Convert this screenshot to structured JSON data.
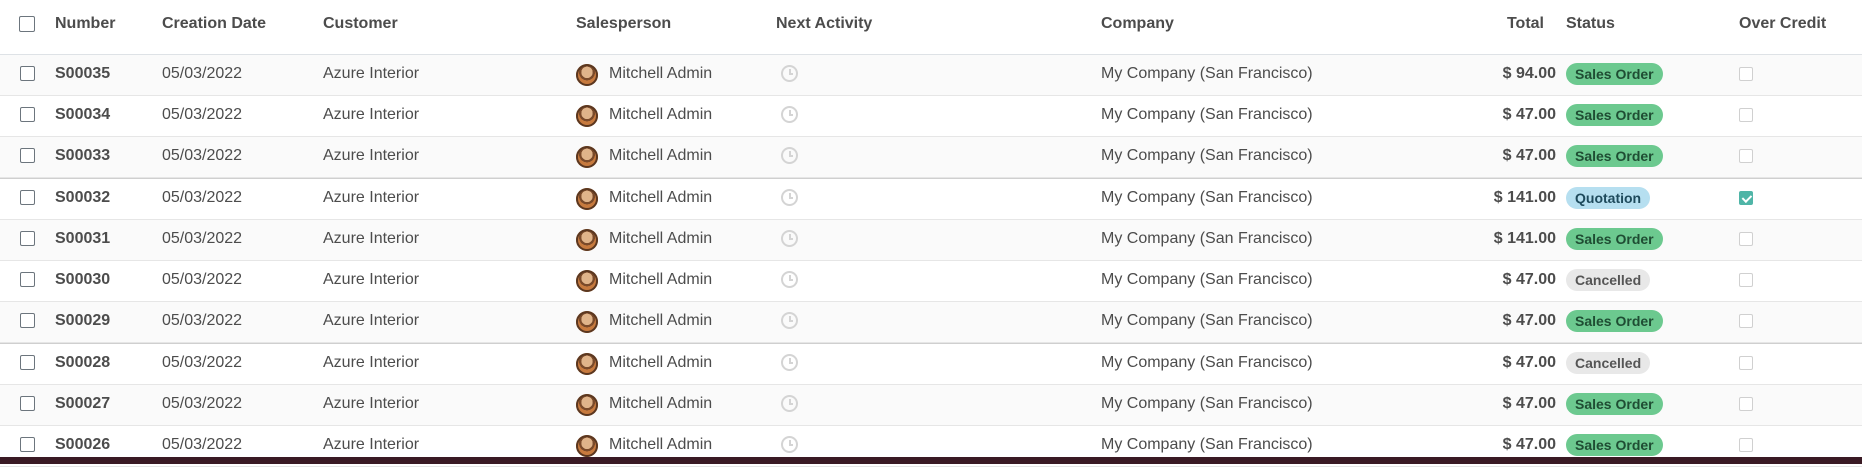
{
  "columns": {
    "number": "Number",
    "creation_date": "Creation Date",
    "customer": "Customer",
    "salesperson": "Salesperson",
    "next_activity": "Next Activity",
    "company": "Company",
    "total": "Total",
    "status": "Status",
    "over_credit": "Over Credit"
  },
  "rows": [
    {
      "number": "S00035",
      "date": "05/03/2022",
      "customer": "Azure Interior",
      "salesperson": "Mitchell Admin",
      "company": "My Company (San Francisco)",
      "total": "$ 94.00",
      "status": "Sales Order",
      "over_credit": false
    },
    {
      "number": "S00034",
      "date": "05/03/2022",
      "customer": "Azure Interior",
      "salesperson": "Mitchell Admin",
      "company": "My Company (San Francisco)",
      "total": "$ 47.00",
      "status": "Sales Order",
      "over_credit": false
    },
    {
      "number": "S00033",
      "date": "05/03/2022",
      "customer": "Azure Interior",
      "salesperson": "Mitchell Admin",
      "company": "My Company (San Francisco)",
      "total": "$ 47.00",
      "status": "Sales Order",
      "over_credit": false
    },
    {
      "number": "S00032",
      "date": "05/03/2022",
      "customer": "Azure Interior",
      "salesperson": "Mitchell Admin",
      "company": "My Company (San Francisco)",
      "total": "$ 141.00",
      "status": "Quotation",
      "over_credit": true
    },
    {
      "number": "S00031",
      "date": "05/03/2022",
      "customer": "Azure Interior",
      "salesperson": "Mitchell Admin",
      "company": "My Company (San Francisco)",
      "total": "$ 141.00",
      "status": "Sales Order",
      "over_credit": false
    },
    {
      "number": "S00030",
      "date": "05/03/2022",
      "customer": "Azure Interior",
      "salesperson": "Mitchell Admin",
      "company": "My Company (San Francisco)",
      "total": "$ 47.00",
      "status": "Cancelled",
      "over_credit": false
    },
    {
      "number": "S00029",
      "date": "05/03/2022",
      "customer": "Azure Interior",
      "salesperson": "Mitchell Admin",
      "company": "My Company (San Francisco)",
      "total": "$ 47.00",
      "status": "Sales Order",
      "over_credit": false
    },
    {
      "number": "S00028",
      "date": "05/03/2022",
      "customer": "Azure Interior",
      "salesperson": "Mitchell Admin",
      "company": "My Company (San Francisco)",
      "total": "$ 47.00",
      "status": "Cancelled",
      "over_credit": false
    },
    {
      "number": "S00027",
      "date": "05/03/2022",
      "customer": "Azure Interior",
      "salesperson": "Mitchell Admin",
      "company": "My Company (San Francisco)",
      "total": "$ 47.00",
      "status": "Sales Order",
      "over_credit": false
    },
    {
      "number": "S00026",
      "date": "05/03/2022",
      "customer": "Azure Interior",
      "salesperson": "Mitchell Admin",
      "company": "My Company (San Francisco)",
      "total": "$ 47.00",
      "status": "Sales Order",
      "over_credit": false
    }
  ],
  "icons": {
    "row_checkbox": "checkbox-icon",
    "salesperson_avatar": "avatar",
    "activity": "clock-icon"
  },
  "colors": {
    "sales_order_badge": "#6cc98f",
    "quotation_badge": "#b6dff0",
    "cancelled_badge": "#e8e8e8",
    "over_credit_checked": "#4fb5a7"
  }
}
